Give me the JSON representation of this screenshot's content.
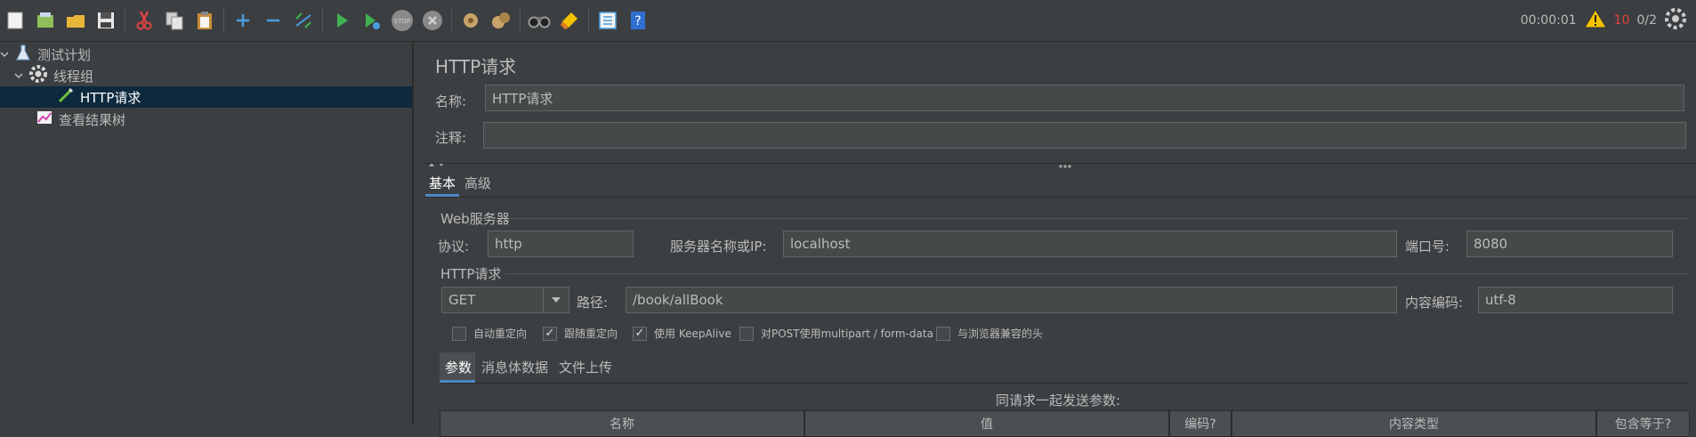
{
  "toolbar": {
    "buttons": [
      "new-icon",
      "templates-icon",
      "open-icon",
      "save-icon",
      "cut-icon",
      "copy-icon",
      "paste-icon",
      "expand-icon",
      "collapse-icon",
      "toggle-icon",
      "start-icon",
      "start-no-pause-icon",
      "stop-icon",
      "shutdown-icon",
      "clear-icon",
      "clear-all-icon",
      "search-icon",
      "reset-search-icon",
      "function-helper-icon",
      "help-icon"
    ],
    "timer": "00:00:01",
    "warning_count": "10",
    "threads": "0/2"
  },
  "tree": {
    "items": [
      {
        "label": "测试计划",
        "icon": "flask-icon"
      },
      {
        "label": "线程组",
        "icon": "gear-icon"
      },
      {
        "label": "HTTP请求",
        "icon": "pipette-icon"
      },
      {
        "label": "查看结果树",
        "icon": "graph-icon"
      }
    ]
  },
  "panel": {
    "title": "HTTP请求",
    "name_label": "名称:",
    "name_value": "HTTP请求",
    "comment_label": "注释:",
    "comment_value": "",
    "tabs": [
      "基本",
      "高级"
    ],
    "web_server": {
      "title": "Web服务器",
      "protocol_label": "协议:",
      "protocol_value": "http",
      "server_label": "服务器名称或IP:",
      "server_value": "localhost",
      "port_label": "端口号:",
      "port_value": "8080"
    },
    "http_request": {
      "title": "HTTP请求",
      "method": "GET",
      "path_label": "路径:",
      "path_value": "/book/allBook",
      "encoding_label": "内容编码:",
      "encoding_value": "utf-8"
    },
    "checkboxes": [
      {
        "label": "自动重定向",
        "checked": false
      },
      {
        "label": "跟随重定向",
        "checked": true
      },
      {
        "label": "使用 KeepAlive",
        "checked": true
      },
      {
        "label": "对POST使用multipart / form-data",
        "checked": false
      },
      {
        "label": "与浏览器兼容的头",
        "checked": false
      }
    ],
    "sub_tabs": [
      "参数",
      "消息体数据",
      "文件上传"
    ],
    "params_caption": "同请求一起发送参数:",
    "table_columns": [
      "名称",
      "值",
      "编码?",
      "内容类型",
      "包含等于?"
    ]
  },
  "colors": {
    "background": "#3c3f41",
    "field": "#45494a",
    "selection": "#0d293e",
    "accent": "#4a88c7",
    "warning": "#e04040"
  }
}
